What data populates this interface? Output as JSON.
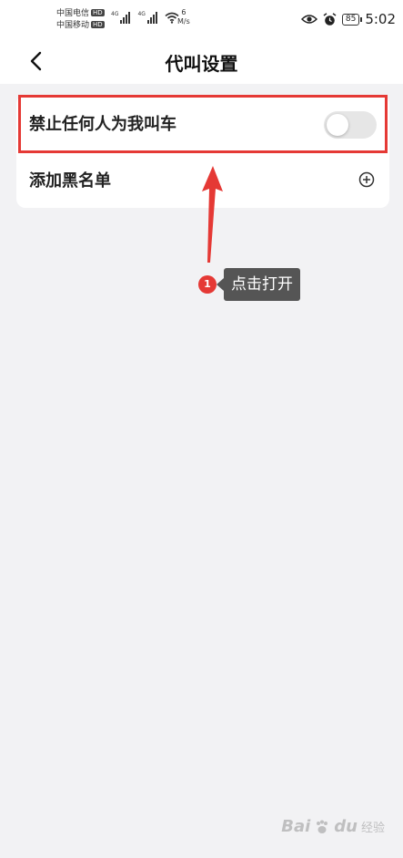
{
  "status_bar": {
    "carrier1": "中国电信",
    "carrier2": "中国移动",
    "hd_badge": "HD",
    "net_label": "4G",
    "speed_value": "6",
    "speed_unit": "M/s",
    "battery": "85",
    "time": "5:02"
  },
  "nav": {
    "title": "代叫设置"
  },
  "settings": {
    "block_all": {
      "label": "禁止任何人为我叫车",
      "enabled": false
    },
    "blacklist": {
      "label": "添加黑名单"
    }
  },
  "annotation": {
    "step_number": "1",
    "tooltip": "点击打开",
    "highlight_color": "#e53935"
  },
  "watermark": {
    "brand": "Bai",
    "brand2": "du",
    "cn": "经验"
  }
}
